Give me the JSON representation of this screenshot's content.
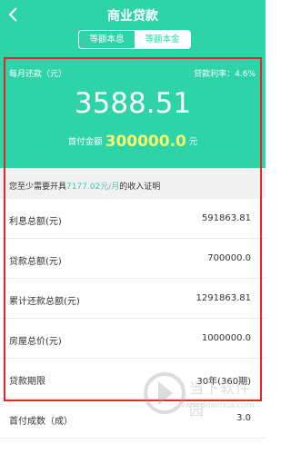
{
  "header": {
    "title": "商业贷款",
    "tabs": [
      {
        "label": "等额本息",
        "active": true
      },
      {
        "label": "等额本金",
        "active": false
      }
    ]
  },
  "summary": {
    "monthly_label": "每月还款（元）",
    "rate_label": "贷款利率：4.6%",
    "monthly_amount": "3588.51",
    "down_payment_label": "首付金额",
    "down_payment_value": "300000.0",
    "down_payment_unit": "元"
  },
  "note": {
    "prefix": "您至少需要开具",
    "highlight": "7177.02元/月",
    "suffix": "的收入证明"
  },
  "rows": [
    {
      "label": "利息总额(元)",
      "value": "591863.81"
    },
    {
      "label": "贷款总额(元)",
      "value": "700000.0"
    },
    {
      "label": "累计还款总额(元)",
      "value": "1291863.81"
    },
    {
      "label": "房屋总价(元)",
      "value": "1000000.0"
    },
    {
      "label": "贷款期限",
      "value": "30年(360期)"
    },
    {
      "label": "首付成数（成）",
      "value": "3.0"
    }
  ],
  "watermark": {
    "text": "当下软件园",
    "url": "www.downxia.com"
  },
  "colors": {
    "accent": "#2ed3a8",
    "highlight_yellow": "#f6f96a",
    "annotation_red": "#e3262a"
  }
}
